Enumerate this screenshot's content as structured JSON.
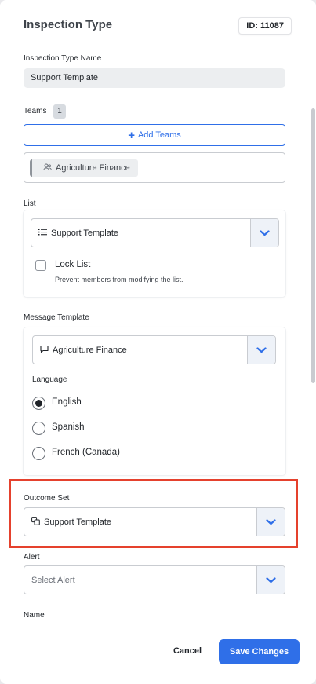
{
  "header": {
    "title": "Inspection Type",
    "id_label": "ID: 11087"
  },
  "inspection_type_name": {
    "label": "Inspection Type Name",
    "value": "Support Template"
  },
  "teams": {
    "label": "Teams",
    "count": "1",
    "add_label": "Add Teams",
    "items": [
      {
        "label": "Agriculture Finance",
        "icon": "users-icon"
      }
    ]
  },
  "list": {
    "label": "List",
    "selected": "Support Template",
    "icon": "list-icon",
    "lock": {
      "label": "Lock List",
      "description": "Prevent members from modifying the list.",
      "checked": false
    }
  },
  "message_template": {
    "label": "Message Template",
    "selected": "Agriculture Finance",
    "icon": "chat-icon",
    "language": {
      "label": "Language",
      "options": [
        "English",
        "Spanish",
        "French (Canada)"
      ],
      "selected": "English"
    }
  },
  "outcome_set": {
    "label": "Outcome Set",
    "selected": "Support Template",
    "icon": "copy-icon"
  },
  "alert": {
    "label": "Alert",
    "placeholder": "Select Alert"
  },
  "name": {
    "label": "Name"
  },
  "footer": {
    "cancel_label": "Cancel",
    "save_label": "Save Changes"
  },
  "colors": {
    "accent": "#2f6fe8",
    "highlight": "#e5412d"
  }
}
